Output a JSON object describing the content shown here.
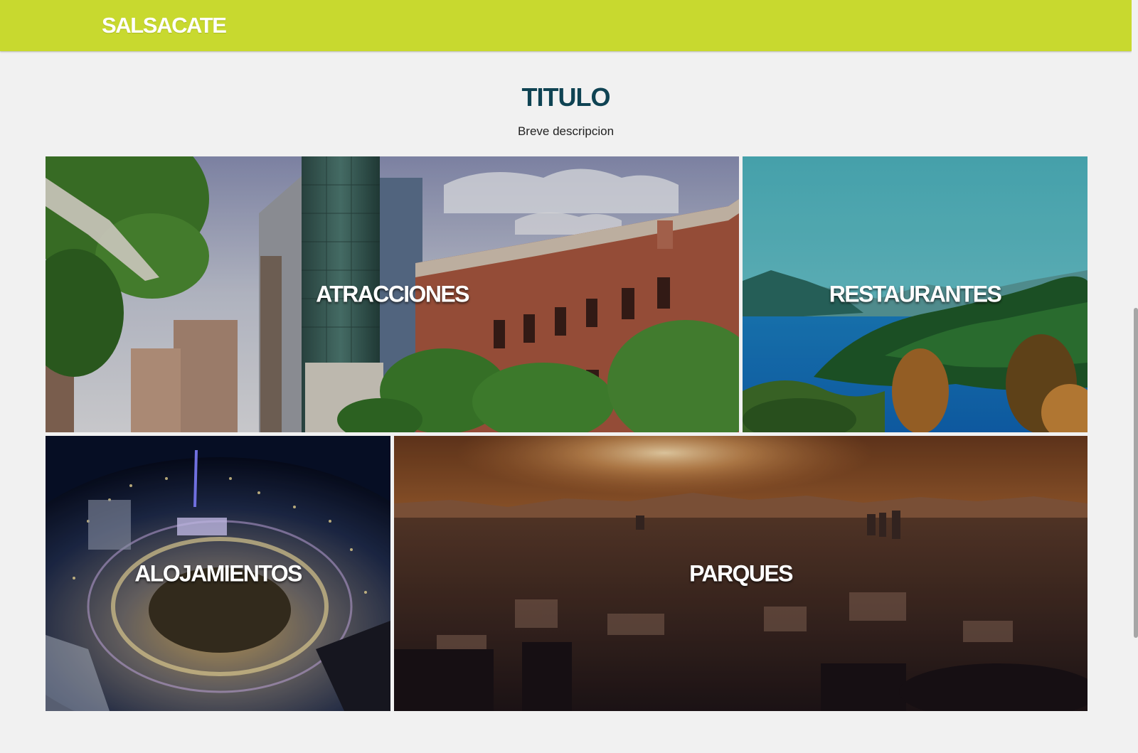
{
  "header": {
    "brand": "SALSACATE",
    "background_color": "#c8d92f"
  },
  "section": {
    "title": "TITULO",
    "description": "Breve descripcion",
    "title_color": "#0f4353"
  },
  "tiles": [
    {
      "label": "ATRACCIONES",
      "image": "city-street-buildings-photo"
    },
    {
      "label": "RESTAURANTES",
      "image": "mountain-lake-photo"
    },
    {
      "label": "ALOJAMIENTOS",
      "image": "night-city-aerial-photo"
    },
    {
      "label": "PARQUES",
      "image": "sunset-city-panorama-photo"
    }
  ]
}
